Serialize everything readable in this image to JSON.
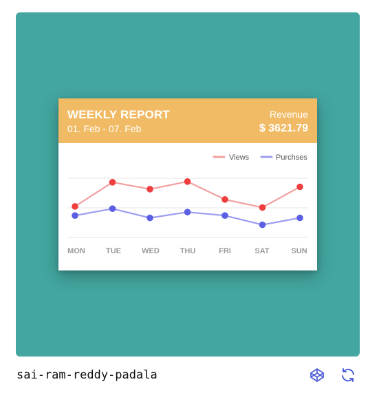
{
  "report": {
    "title": "WEEKLY REPORT",
    "date_range": "01. Feb - 07. Feb",
    "revenue_label": "Revenue",
    "revenue_value": "$ 3621.79"
  },
  "colors": {
    "background": "#43a6a0",
    "header": "#f1bb66",
    "views_line": "#f2a09f",
    "views_point": "#ee3e3e",
    "purchases_line": "#9b9cf0",
    "purchases_point": "#5b5fe3",
    "accent_icon": "#4e5fd6"
  },
  "chart_data": {
    "type": "line",
    "categories": [
      "MON",
      "TUE",
      "WED",
      "THU",
      "FRI",
      "SAT",
      "SUN"
    ],
    "series": [
      {
        "name": "Views",
        "values": [
          13.5,
          24.0,
          21.0,
          24.3,
          16.5,
          13.0,
          22.0
        ]
      },
      {
        "name": "Purchses",
        "values": [
          9.5,
          12.5,
          8.5,
          11.0,
          9.5,
          5.5,
          8.5
        ]
      }
    ],
    "ylim": [
      0,
      35
    ],
    "grid": true,
    "legend": "top-right",
    "title": "",
    "xlabel": "",
    "ylabel": ""
  },
  "footer": {
    "username": "sai-ram-reddy-padala",
    "codepen_icon": "codepen-icon",
    "refresh_icon": "refresh-icon"
  }
}
